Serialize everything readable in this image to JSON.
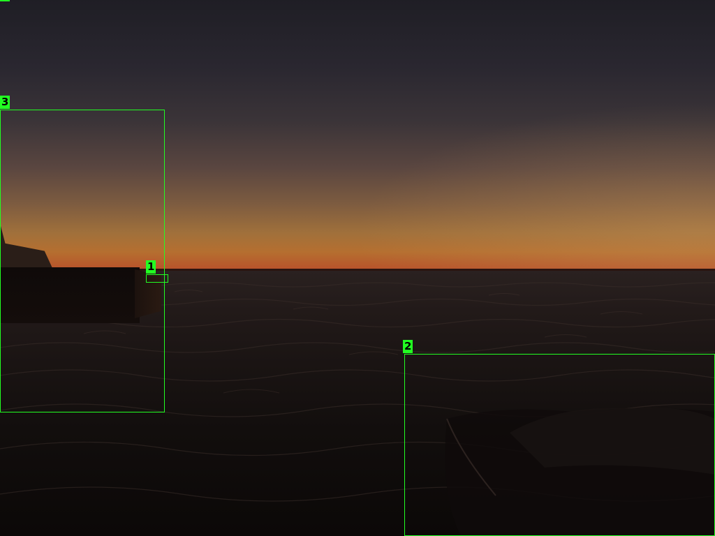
{
  "scene": {
    "description_free": true,
    "colors": {
      "sky_top": "#1f1e25",
      "horizon_glow": "#b8502a",
      "sea": "#1a1413",
      "overlay_box": "#22ff22"
    }
  },
  "overlays": [
    {
      "id": "1",
      "label": "1"
    },
    {
      "id": "2",
      "label": "2"
    },
    {
      "id": "3",
      "label": "3"
    }
  ]
}
